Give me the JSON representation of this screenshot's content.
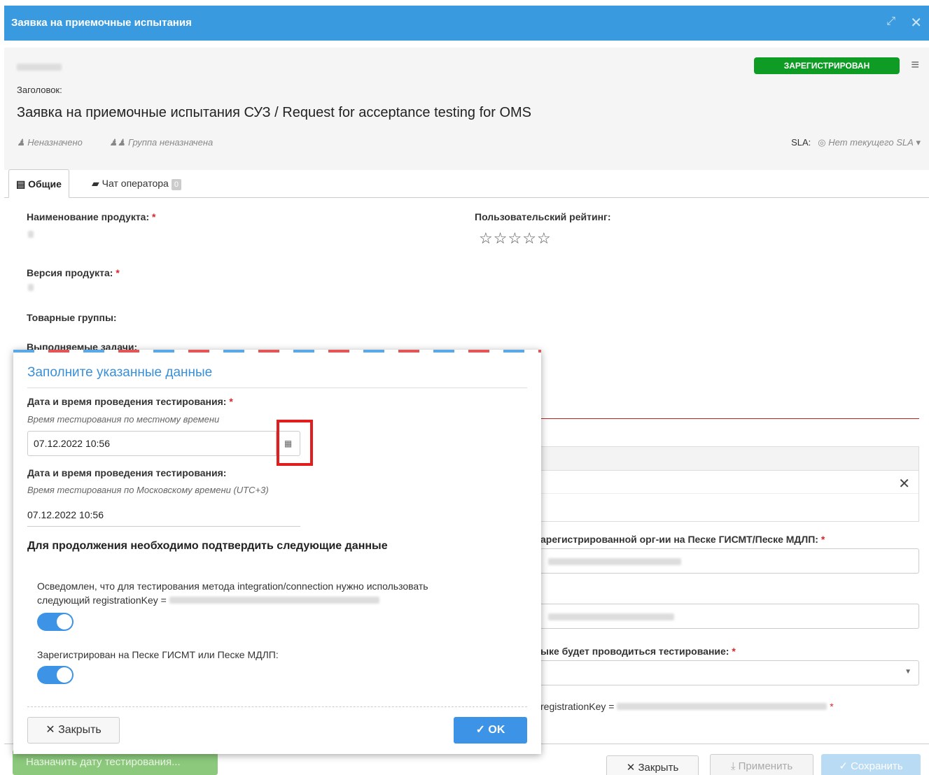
{
  "window": {
    "title": "Заявка на приемочные испытания",
    "expand_icon": "expand-icon",
    "close_icon": "close-icon"
  },
  "ticket": {
    "status": "ЗАРЕГИСТРИРОВАН",
    "title_label": "Заголовок:",
    "title": "Заявка на приемочные испытания СУЗ / Request for acceptance testing for OMS",
    "assignee": "Неназначено",
    "group": "Группа неназначена",
    "sla_label": "SLA:",
    "sla_value": "Нет текущего SLA"
  },
  "tabs": [
    {
      "label": "Общие"
    },
    {
      "label": "Чат оператора",
      "count": "0"
    }
  ],
  "form": {
    "product_name_label": "Наименование продукта:",
    "rating_label": "Пользовательский рейтинг:",
    "rating_value": 0,
    "rating_max": 5,
    "version_label": "Версия продукта:",
    "product_groups_label": "Товарные группы:",
    "tasks_label": "Выполняемые задачи:",
    "org_label_partial": "арегистрированной орг-ии на Песке ГИСМТ/Песке МДЛП:",
    "env_label_partial": "ыке будет проводиться тестирование:",
    "regkey_label_partial": "registrationKey ="
  },
  "footer": {
    "assign_label": "Назначить дату тестирования...",
    "close_label": "Закрыть",
    "apply_label": "Применить",
    "save_label": "Сохранить"
  },
  "modal": {
    "title": "Заполните указанные данные",
    "date_label": "Дата и время проведения тестирования:",
    "local_hint": "Время тестирования по местному времени",
    "local_value": "07.12.2022 10:56",
    "date_label_msk": "Дата и время проведения тестирования:",
    "msk_hint": "Время тестирования по Московскому времени (UTC+3)",
    "msk_value": "07.12.2022 10:56",
    "confirm_title": "Для продолжения необходимо подтвердить следующие данные",
    "confirm1_text_line1": "Осведомлен, что для тестирования метода integration/connection нужно использовать",
    "confirm1_text_line2": "следующий registrationKey =",
    "confirm1_on": true,
    "confirm2_text": "Зарегистрирован на Песке ГИСМТ или Песке МДЛП:",
    "confirm2_on": true,
    "close_label": "Закрыть",
    "ok_label": "OK"
  },
  "colors": {
    "titlebar": "#3a9ae0",
    "status": "#0e9c24",
    "accent": "#3d94e6",
    "required": "#d9262c",
    "highlight": "#e01e1e"
  }
}
